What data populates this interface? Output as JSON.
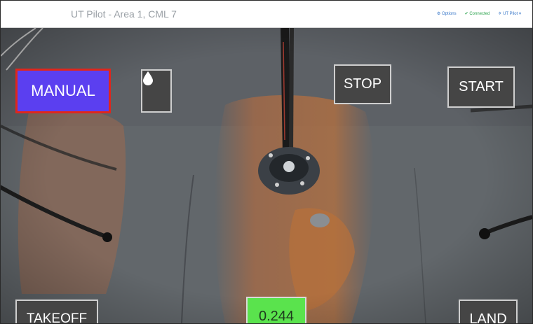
{
  "window": {
    "title": "UT Pilot - Area 1, CML 7",
    "nav": {
      "options": "Options",
      "connected": "Connected",
      "pilot": "UT Pilot"
    }
  },
  "controls": {
    "mode_label": "MANUAL",
    "couplant_icon": "droplet-icon",
    "stop_label": "STOP",
    "start_label": "START",
    "takeoff_label": "TAKEOFF",
    "thickness_reading": "0.244",
    "land_label": "LAND"
  },
  "colors": {
    "manual_bg": "#5b3ff0",
    "manual_border": "#e0261c",
    "reading_bg": "#5ae34d",
    "connected": "#2ea44f",
    "link": "#3a78c9"
  }
}
